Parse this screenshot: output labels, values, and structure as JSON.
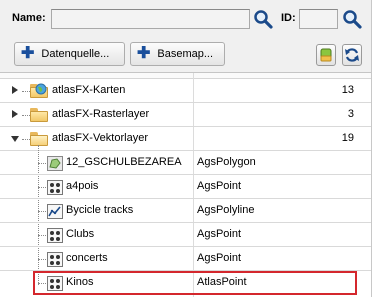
{
  "search": {
    "name_label": "Name:",
    "name_value": "",
    "id_label": "ID:",
    "id_value": ""
  },
  "toolbar": {
    "datenquelle_label": "Datenquelle...",
    "basemap_label": "Basemap..."
  },
  "tree": {
    "groups": [
      {
        "name": "atlasFX-Karten",
        "count": "13",
        "expanded": false
      },
      {
        "name": "atlasFX-Rasterlayer",
        "count": "3",
        "expanded": false
      },
      {
        "name": "atlasFX-Vektorlayer",
        "count": "19",
        "expanded": true
      }
    ],
    "layers": [
      {
        "name": "12_GSCHULBEZAREA",
        "type": "AgsPolygon",
        "icon": "polygon-layer-icon"
      },
      {
        "name": "a4pois",
        "type": "AgsPoint",
        "icon": "point-layer-icon"
      },
      {
        "name": "Bycicle tracks",
        "type": "AgsPolyline",
        "icon": "polyline-layer-icon"
      },
      {
        "name": "Clubs",
        "type": "AgsPoint",
        "icon": "point-layer-icon"
      },
      {
        "name": "concerts",
        "type": "AgsPoint",
        "icon": "point-layer-icon"
      },
      {
        "name": "Kinos",
        "type": "AtlasPoint",
        "icon": "point-layer-icon",
        "selected": true
      }
    ]
  },
  "colors": {
    "selection_border": "#d4272d",
    "button_blue": "#1a4f9c"
  }
}
